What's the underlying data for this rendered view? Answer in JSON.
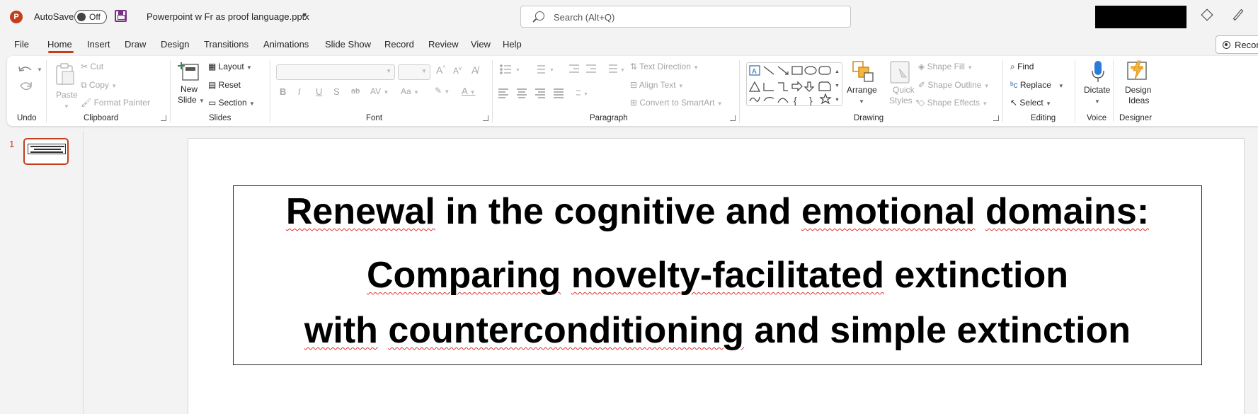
{
  "titlebar": {
    "app_logo": "P",
    "autosave_label": "AutoSave",
    "autosave_state": "Off",
    "document_title": "Powerpoint w Fr as proof language.pptx",
    "search_placeholder": "Search (Alt+Q)"
  },
  "menu": {
    "tabs": [
      "File",
      "Home",
      "Insert",
      "Draw",
      "Design",
      "Transitions",
      "Animations",
      "Slide Show",
      "Record",
      "Review",
      "View",
      "Help"
    ],
    "active_tab": "Home",
    "record_button": "Record"
  },
  "ribbon": {
    "undo": {
      "label": "Undo"
    },
    "clipboard": {
      "label": "Clipboard",
      "paste": "Paste",
      "cut": "Cut",
      "copy": "Copy",
      "format_painter": "Format Painter"
    },
    "slides": {
      "label": "Slides",
      "new_slide_line1": "New",
      "new_slide_line2": "Slide",
      "layout": "Layout",
      "reset": "Reset",
      "section": "Section"
    },
    "font": {
      "label": "Font",
      "bold": "B",
      "italic": "I",
      "underline": "U",
      "shadow": "S",
      "strike": "ab",
      "spacing": "AV",
      "case": "Aa",
      "color": "A",
      "grow": "A",
      "shrink": "A"
    },
    "paragraph": {
      "label": "Paragraph",
      "text_direction": "Text Direction",
      "align_text": "Align Text",
      "smartart": "Convert to SmartArt"
    },
    "drawing": {
      "label": "Drawing",
      "arrange": "Arrange",
      "quick_styles_line1": "Quick",
      "quick_styles_line2": "Styles",
      "shape_fill": "Shape Fill",
      "shape_outline": "Shape Outline",
      "shape_effects": "Shape Effects"
    },
    "editing": {
      "label": "Editing",
      "find": "Find",
      "replace": "Replace",
      "select": "Select"
    },
    "voice": {
      "label": "Voice",
      "dictate": "Dictate"
    },
    "designer": {
      "label": "Designer",
      "design_ideas_line1": "Design",
      "design_ideas_line2": "Ideas"
    }
  },
  "slides_pane": {
    "slide_number": "1"
  },
  "slide": {
    "title_line1": {
      "w1": "Renewal",
      "w2": " in the cognitive and ",
      "w3": "emotional",
      "w4": " ",
      "w5": "domains:"
    },
    "title_line2": {
      "w1": "Comparing",
      "w2": " ",
      "w3": "novelty-facilitated",
      "w4": " extinction"
    },
    "title_line3": {
      "w1": "with",
      "w2": " ",
      "w3": "counterconditioning",
      "w4": " and simple extinction"
    }
  },
  "colors": {
    "accent": "#c43e1c",
    "ribbon_bg": "#ffffff",
    "chrome_bg": "#f3f3f3"
  }
}
